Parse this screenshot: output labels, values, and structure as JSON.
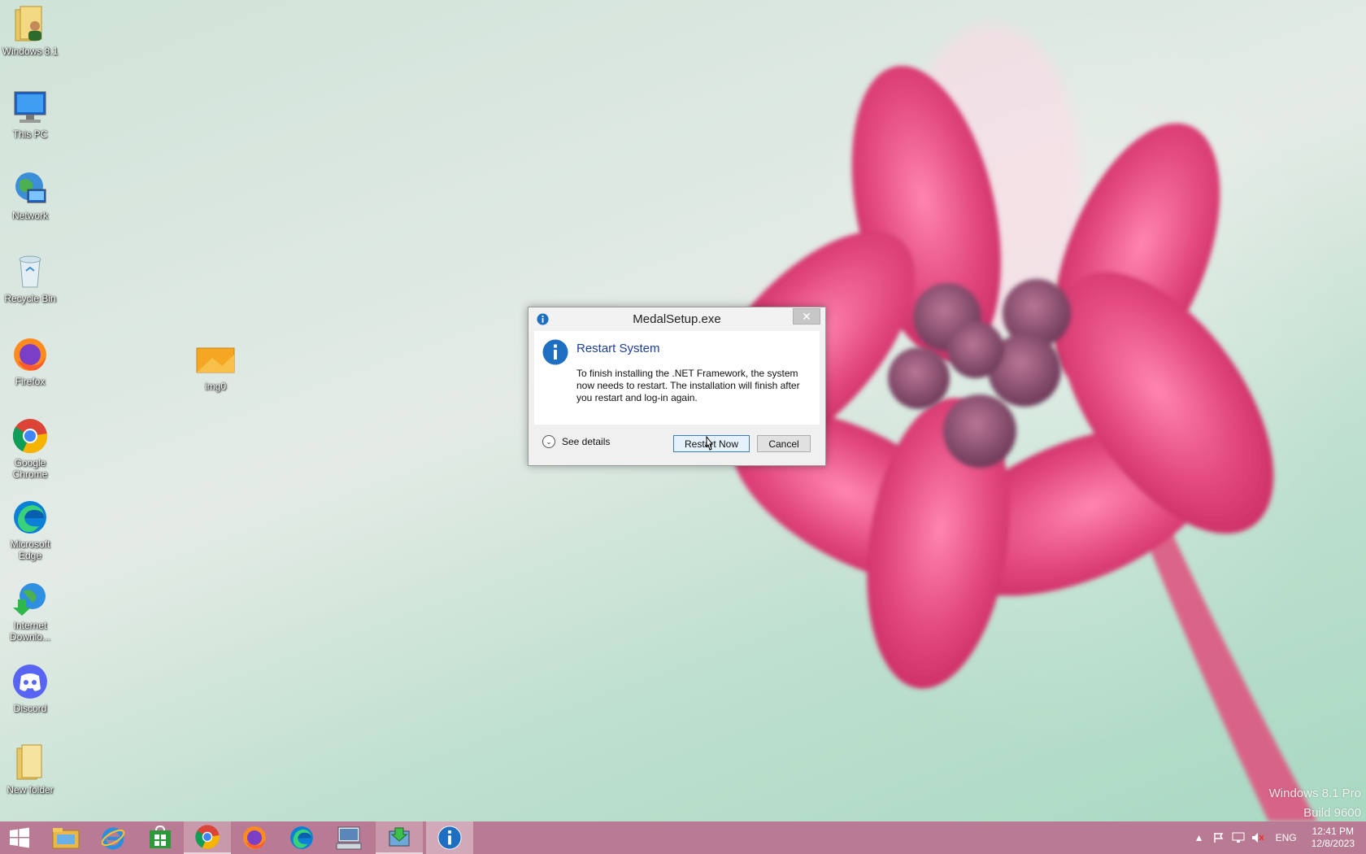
{
  "desktop": {
    "icons": [
      {
        "label": "Windows 8.1",
        "icon": "user-folder-icon"
      },
      {
        "label": "This PC",
        "icon": "computer-icon"
      },
      {
        "label": "Network",
        "icon": "network-globe-icon"
      },
      {
        "label": "Recycle Bin",
        "icon": "recycle-bin-icon"
      },
      {
        "label": "Firefox",
        "icon": "firefox-icon"
      },
      {
        "label": "Google Chrome",
        "icon": "chrome-icon"
      },
      {
        "label": "Microsoft Edge",
        "icon": "edge-icon"
      },
      {
        "label": "Internet Downlo...",
        "icon": "idm-icon"
      },
      {
        "label": "Discord",
        "icon": "discord-icon"
      },
      {
        "label": "New folder",
        "icon": "folder-icon"
      },
      {
        "label": "img0",
        "icon": "image-file-icon"
      }
    ],
    "watermark": {
      "line1": "Windows 8.1 Pro",
      "line2": "Build 9600"
    }
  },
  "dialog": {
    "title": "MedalSetup.exe",
    "close_label": "✕",
    "heading": "Restart System",
    "message": "To finish installing the .NET Framework, the system now needs to restart.  The installation will finish after you restart and log-in again.",
    "details_label": "See details",
    "restart_label": "Restart Now",
    "cancel_label": "Cancel"
  },
  "taskbar": {
    "items": [
      {
        "name": "start-button",
        "icon": "windows-logo-icon"
      },
      {
        "name": "file-explorer",
        "icon": "folder-icon"
      },
      {
        "name": "internet-explorer",
        "icon": "ie-icon"
      },
      {
        "name": "store",
        "icon": "store-icon"
      },
      {
        "name": "chrome",
        "icon": "chrome-icon",
        "active": true
      },
      {
        "name": "firefox",
        "icon": "firefox-icon"
      },
      {
        "name": "edge",
        "icon": "edge-icon"
      },
      {
        "name": "remote-desktop",
        "icon": "keyboard-monitor-icon"
      },
      {
        "name": "setup",
        "icon": "installer-icon",
        "active": true
      },
      {
        "name": "info-dialog",
        "icon": "info-icon",
        "current": true
      }
    ],
    "tray": {
      "language": "ENG",
      "time": "12:41 PM",
      "date": "12/8/2023"
    }
  },
  "colors": {
    "taskbar": "#b97b94",
    "dialog_heading": "#1c3f9c",
    "info_blue": "#1e6fc1",
    "petal": "#e2487e"
  }
}
